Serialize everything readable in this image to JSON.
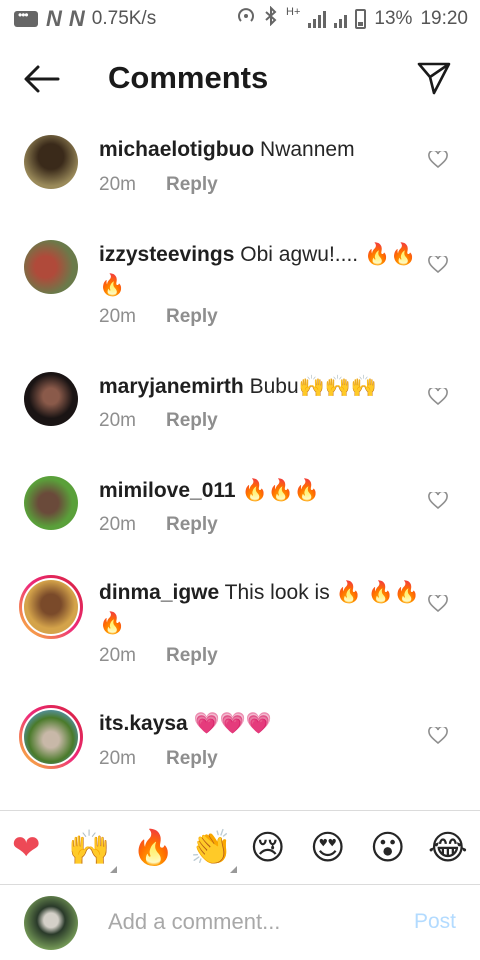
{
  "status_bar": {
    "network_speed": "0.75K/s",
    "network_type": "H+",
    "battery": "13%",
    "time": "19:20",
    "icons": [
      "message-icon",
      "n-notification-icon",
      "n-notification-icon",
      "hotspot-icon",
      "bluetooth-icon",
      "signal-icon",
      "battery-icon"
    ]
  },
  "header": {
    "title": "Comments",
    "back_icon": "arrow-left-icon",
    "share_icon": "paper-plane-icon"
  },
  "comments": [
    {
      "username": "michaelotigbuo",
      "text": "Nwannem",
      "time": "20m",
      "reply": "Reply",
      "story_ring": false,
      "avatar_color": "#5a4a3a"
    },
    {
      "username": "izzysteevings",
      "text": "Obi agwu!.... 🔥🔥🔥",
      "time": "20m",
      "reply": "Reply",
      "story_ring": false,
      "avatar_color": "#8a6a4a"
    },
    {
      "username": "maryjanemirth",
      "text": "Bubu🙌🙌🙌",
      "time": "20m",
      "reply": "Reply",
      "story_ring": false,
      "avatar_color": "#2a2222"
    },
    {
      "username": "mimilove_011",
      "text": "🔥🔥🔥",
      "time": "20m",
      "reply": "Reply",
      "story_ring": false,
      "avatar_color": "#4a7a3a"
    },
    {
      "username": "dinma_igwe",
      "text": "This look is 🔥 🔥🔥🔥",
      "time": "20m",
      "reply": "Reply",
      "story_ring": true,
      "avatar_color": "#6a4a3a"
    },
    {
      "username": "its.kaysa",
      "text": "💗💗💗",
      "time": "20m",
      "reply": "Reply",
      "story_ring": true,
      "avatar_color": "#5a6a3a"
    }
  ],
  "reactions": [
    "❤",
    "🙌",
    "🔥",
    "👏",
    "😢",
    "😍",
    "😮",
    "😂"
  ],
  "composer": {
    "placeholder": "Add a comment...",
    "post_label": "Post",
    "avatar_color": "#3a5a3a"
  }
}
